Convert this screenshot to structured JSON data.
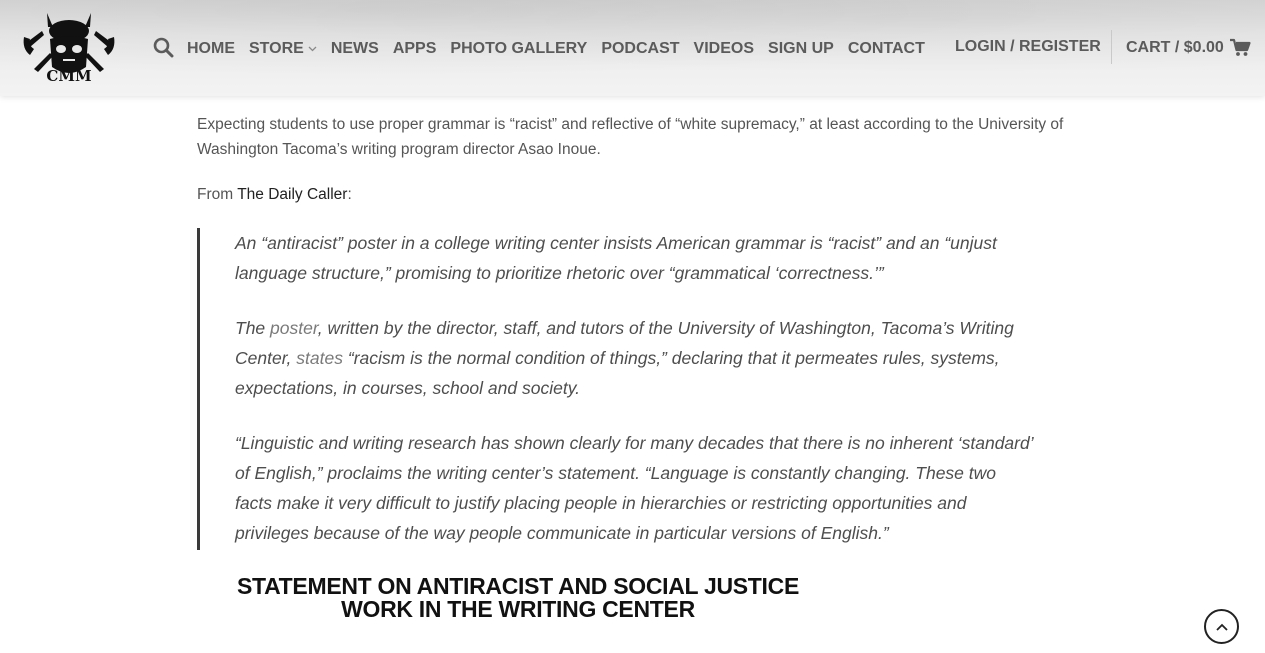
{
  "header": {
    "nav": [
      "HOME",
      "STORE",
      "NEWS",
      "APPS",
      "PHOTO GALLERY",
      "PODCAST",
      "VIDEOS",
      "SIGN UP",
      "CONTACT"
    ],
    "login": "LOGIN / REGISTER",
    "cart": "CART / $0.00",
    "icons": {
      "search": "search-icon",
      "store_dropdown": "chevron-down-icon",
      "cart": "cart-icon",
      "logo": "logo-icon"
    }
  },
  "article": {
    "lead": "Expecting students to use proper grammar is “racist” and reflective of “white supremacy,” at least according to the University of Washington Tacoma’s writing program director Asao Inoue.",
    "from_prefix": "From ",
    "source": "The Daily Caller",
    "from_suffix": ":",
    "quote": {
      "p1": "An “antiracist” poster in a college writing center insists American grammar is “racist” and an “unjust language structure,” promising to prioritize rhetoric over “grammatical ‘correctness.’”",
      "p2_a": "The ",
      "p2_link1": "poster",
      "p2_b": ", written by the director, staff, and tutors of the University of Washington, Tacoma’s Writing Center, ",
      "p2_link2": "states",
      "p2_c": " “racism is the normal condition of things,” declaring that it permeates rules, systems, expectations, in courses, school and society.",
      "p3": "“Linguistic and writing research has shown clearly for many decades that there is no inherent ‘standard’ of English,” proclaims the writing center’s statement. “Language is constantly changing. These two facts make it very difficult to justify placing people in hierarchies or restricting opportunities and privileges because of the way people communicate in particular versions of English.”"
    },
    "poster_title_line1": "STATEMENT ON ANTIRACIST AND SOCIAL JUSTICE",
    "poster_title_line2": "WORK IN THE WRITING CENTER"
  },
  "back_to_top": "chevron-up-icon"
}
